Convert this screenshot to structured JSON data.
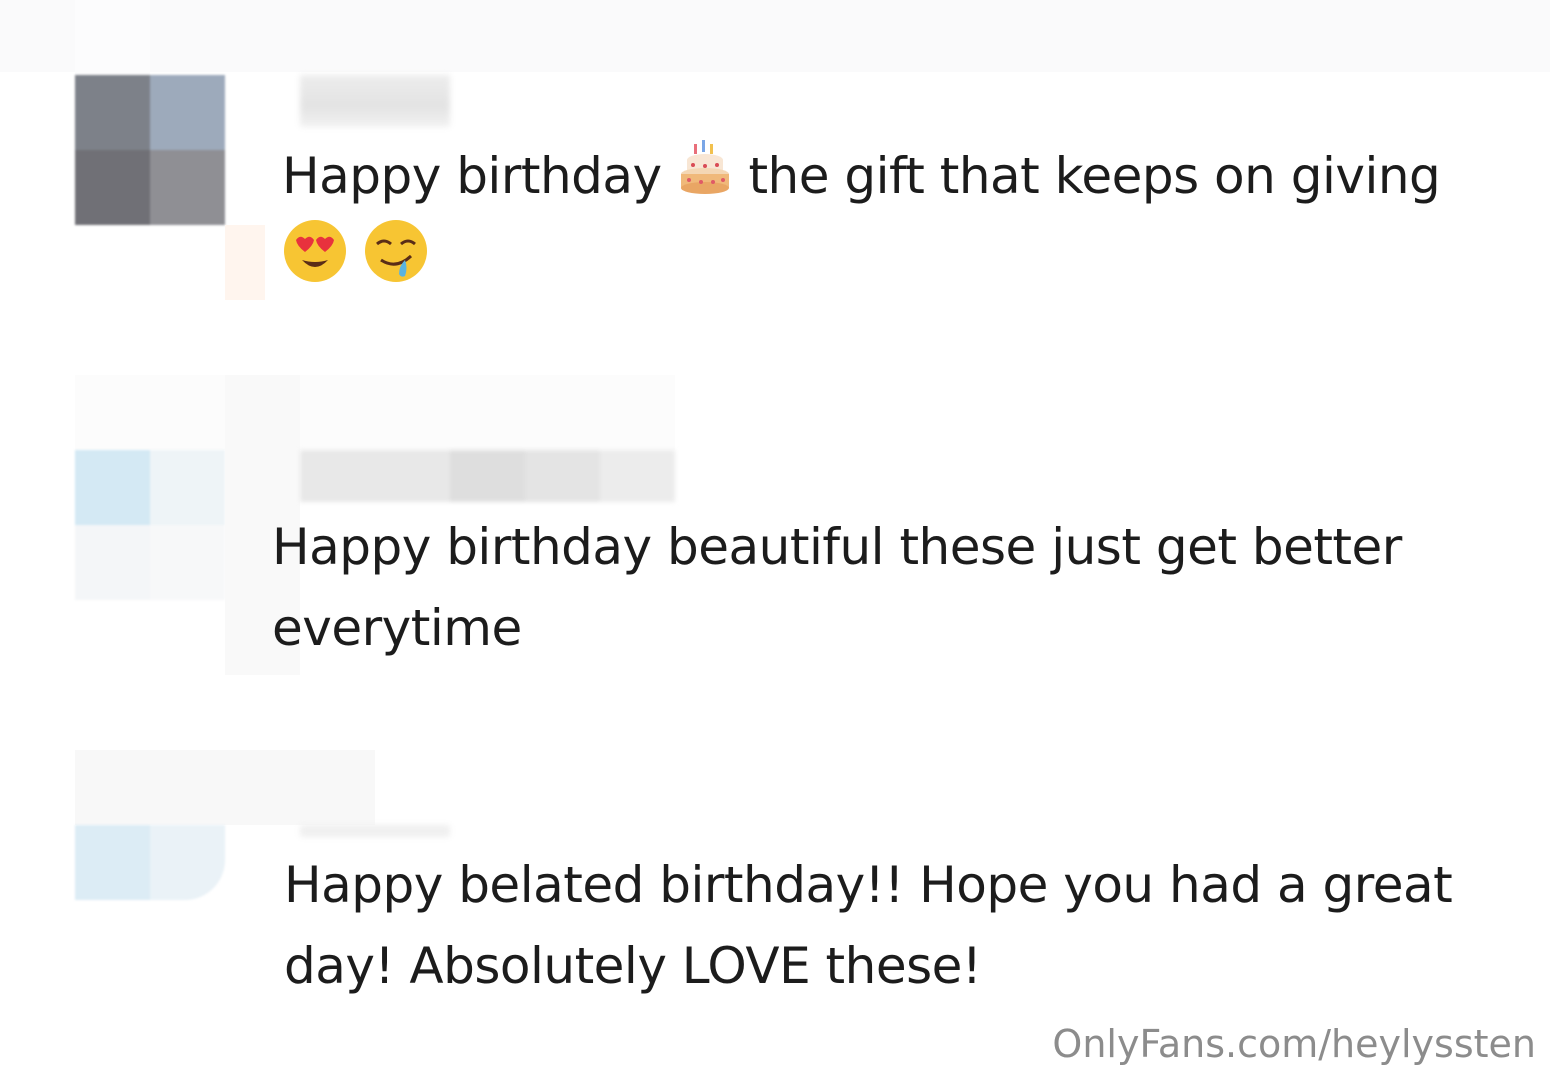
{
  "comments": [
    {
      "line1_before": "Happy birthday ",
      "emoji_cake": "birthday-cake-icon",
      "line1_after": " the gift that keeps on giving",
      "emojis_line2": [
        "heart-eyes-face-icon",
        "drooling-face-icon"
      ]
    },
    {
      "line1": "Happy birthday beautiful these just get better",
      "line2": "everytime"
    },
    {
      "line1": "Happy belated birthday!! Hope you had a great",
      "line2": "day! Absolutely LOVE these!"
    }
  ],
  "watermark": "OnlyFans.com/heylyssten",
  "colors": {
    "text": "#1c1c1c",
    "watermark": "#8c8c8c",
    "background": "#ffffff"
  }
}
